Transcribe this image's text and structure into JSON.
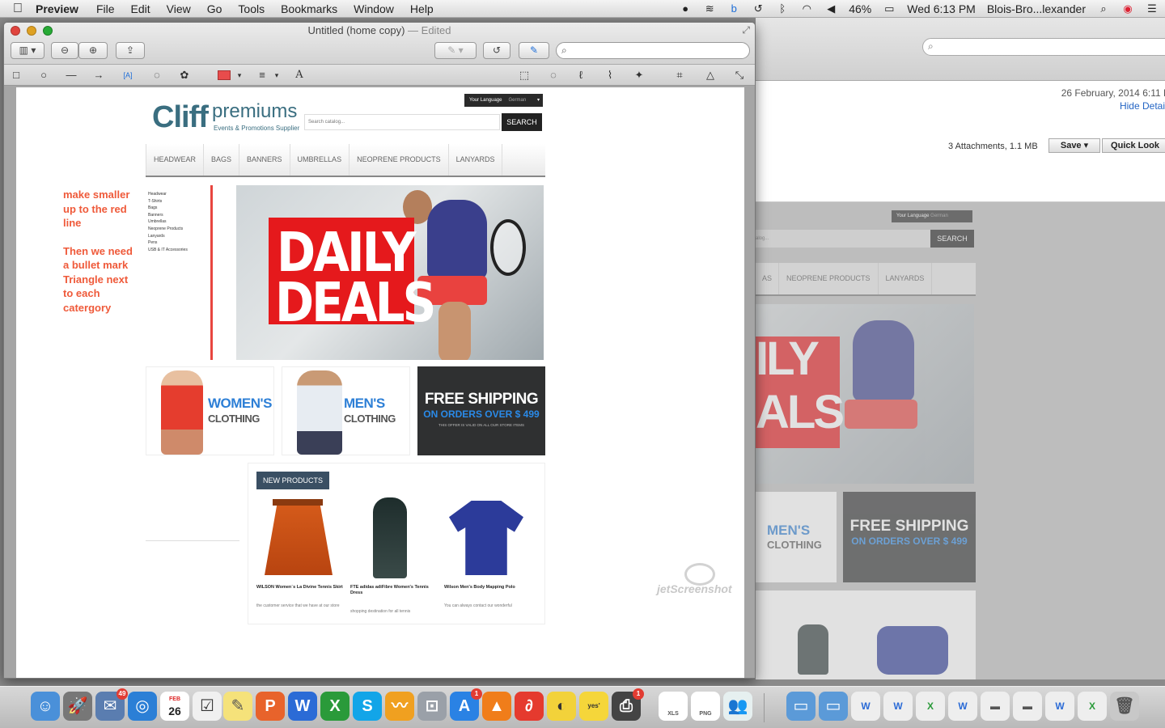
{
  "menubar": {
    "app_name": "Preview",
    "items": [
      "File",
      "Edit",
      "View",
      "Go",
      "Tools",
      "Bookmarks",
      "Window",
      "Help"
    ],
    "battery": "46%",
    "clock": "Wed 6:13 PM",
    "user": "Blois-Bro...lexander"
  },
  "preview_window": {
    "title": "Untitled (home copy)",
    "title_sep": " — ",
    "status": "Edited"
  },
  "annotation_note": {
    "line1": "make smaller",
    "line2": "up to the red",
    "line3": "line",
    "line4": "Then we need",
    "line5": "a bullet mark",
    "line6": "Triangle next",
    "line7": "to each",
    "line8": "catergory"
  },
  "store": {
    "logo_main": "Cliff",
    "logo_premiums": "premiums",
    "logo_tagline": "Events & Promotions Supplier",
    "language_label": "Your Language",
    "language_value": "German",
    "language_arrow": "▾",
    "search_placeholder": "Search catalog...",
    "search_button": "SEARCH",
    "nav": [
      "HEADWEAR",
      "BAGS",
      "BANNERS",
      "UMBRELLAS",
      "NEOPRENE PRODUCTS",
      "LANYARDS"
    ],
    "sidebar": [
      "Headwear",
      "T-Shirts",
      "Bags",
      "Banners",
      "Umbrellas",
      "Neoprene Products",
      "Lanyards",
      "Pens",
      "USB & IT Accessories"
    ],
    "hero_line1": "DAILY",
    "hero_line2": "DEALS",
    "promo_women_title": "WOMEN'S",
    "promo_women_sub": "CLOTHING",
    "promo_men_title": "MEN'S",
    "promo_men_sub": "CLOTHING",
    "free_title": "FREE SHIPPING",
    "free_sub": "ON ORDERS OVER $ 499",
    "free_small": "THIS OFFER IS VALID ON ALL OUR STORE ITEMS",
    "new_products_tab": "NEW PRODUCTS",
    "products": [
      {
        "name": "WILSON Women`s La Divine Tennis Skirt",
        "desc": "the customer service that we have at our store"
      },
      {
        "name": "FTE adidas adiFibre Women's Tennis Dress",
        "desc": "shopping destination for all tennis"
      },
      {
        "name": "Wilson Men's Body Mapping Polo",
        "desc": "You can always contact our wonderful"
      }
    ],
    "watermark": "jetScreenshot"
  },
  "mail": {
    "date": "26 February, 2014 6:11 P",
    "hide_details": "Hide Detai",
    "attachments": "3 Attachments, 1.1 MB",
    "save_button": "Save",
    "quick_look": "Quick Look",
    "ghost_nav": [
      "AS",
      "NEOPRENE PRODUCTS",
      "LANYARDS"
    ],
    "ghost_hero1": "ILY",
    "ghost_hero2": "ALS"
  },
  "dock": {
    "mail_badge": "49",
    "calendar_month": "FEB",
    "calendar_day": "26",
    "appstore_badge": "1",
    "printer_badge": "1",
    "xls_label": "XLS",
    "png_label": "PNG"
  }
}
